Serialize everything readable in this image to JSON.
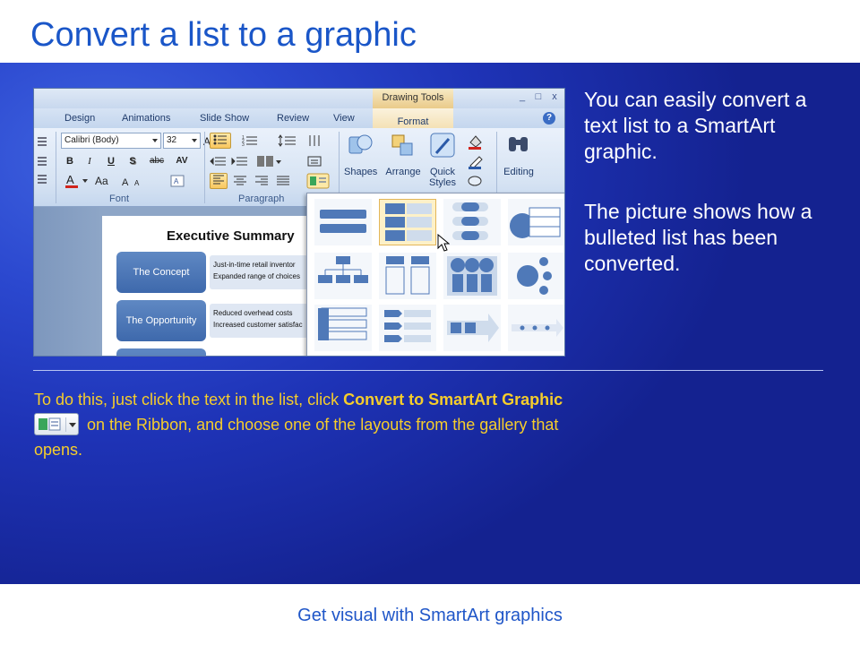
{
  "slide": {
    "title": "Convert a list to a graphic",
    "footer": "Get visual with SmartArt graphics",
    "side_text": [
      "You can easily convert a text list to a SmartArt graphic.",
      "The picture shows how a bulleted list has been converted."
    ],
    "body": {
      "part1": "To do this, just click the text in the list, click ",
      "bold1": "Convert to SmartArt Graphic",
      "part2": " on the Ribbon, and choose one of the layouts from the gallery that opens."
    },
    "colors": {
      "title": "#1a56c8",
      "body_text": "#f6cd2b",
      "side_text": "#ffffff",
      "background": "#2b48cf"
    }
  },
  "screenshot": {
    "contextual_tab": "Drawing Tools",
    "tabs": [
      "Design",
      "Animations",
      "Slide Show",
      "Review",
      "View",
      "Format"
    ],
    "window_buttons": [
      "_",
      "□",
      "x"
    ],
    "help": "?",
    "font": {
      "name": "Calibri (Body)",
      "size": "32",
      "group_label": "Font"
    },
    "paragraph_group_label": "Paragraph",
    "buttons": {
      "bold": "B",
      "italic": "I",
      "underline": "U",
      "shadow": "S",
      "strike": "abc",
      "spacing": "AV",
      "shapes": "Shapes",
      "arrange": "Arrange",
      "quick_styles": "Quick Styles",
      "editing": "Editing"
    },
    "document": {
      "heading": "Executive Summary",
      "rows": [
        {
          "label": "The Concept",
          "bullets": [
            "Just-in-time retail inventor",
            "Expanded range of choices"
          ]
        },
        {
          "label": "The Opportunity",
          "bullets": [
            "Reduced overhead costs",
            "Increased customer satisfac"
          ]
        }
      ]
    }
  }
}
